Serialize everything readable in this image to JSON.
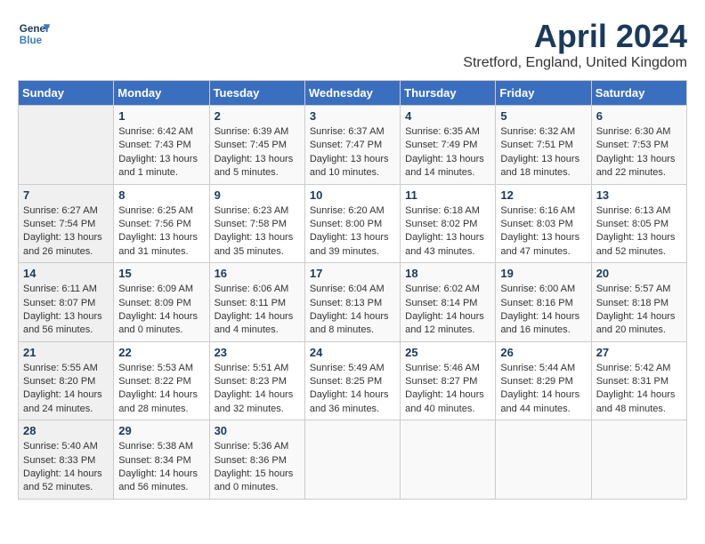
{
  "header": {
    "logo_general": "General",
    "logo_blue": "Blue",
    "title": "April 2024",
    "subtitle": "Stretford, England, United Kingdom"
  },
  "calendar": {
    "columns": [
      "Sunday",
      "Monday",
      "Tuesday",
      "Wednesday",
      "Thursday",
      "Friday",
      "Saturday"
    ],
    "weeks": [
      [
        {
          "day": "",
          "sunrise": "",
          "sunset": "",
          "daylight": ""
        },
        {
          "day": "1",
          "sunrise": "Sunrise: 6:42 AM",
          "sunset": "Sunset: 7:43 PM",
          "daylight": "Daylight: 13 hours and 1 minute."
        },
        {
          "day": "2",
          "sunrise": "Sunrise: 6:39 AM",
          "sunset": "Sunset: 7:45 PM",
          "daylight": "Daylight: 13 hours and 5 minutes."
        },
        {
          "day": "3",
          "sunrise": "Sunrise: 6:37 AM",
          "sunset": "Sunset: 7:47 PM",
          "daylight": "Daylight: 13 hours and 10 minutes."
        },
        {
          "day": "4",
          "sunrise": "Sunrise: 6:35 AM",
          "sunset": "Sunset: 7:49 PM",
          "daylight": "Daylight: 13 hours and 14 minutes."
        },
        {
          "day": "5",
          "sunrise": "Sunrise: 6:32 AM",
          "sunset": "Sunset: 7:51 PM",
          "daylight": "Daylight: 13 hours and 18 minutes."
        },
        {
          "day": "6",
          "sunrise": "Sunrise: 6:30 AM",
          "sunset": "Sunset: 7:53 PM",
          "daylight": "Daylight: 13 hours and 22 minutes."
        }
      ],
      [
        {
          "day": "7",
          "sunrise": "Sunrise: 6:27 AM",
          "sunset": "Sunset: 7:54 PM",
          "daylight": "Daylight: 13 hours and 26 minutes."
        },
        {
          "day": "8",
          "sunrise": "Sunrise: 6:25 AM",
          "sunset": "Sunset: 7:56 PM",
          "daylight": "Daylight: 13 hours and 31 minutes."
        },
        {
          "day": "9",
          "sunrise": "Sunrise: 6:23 AM",
          "sunset": "Sunset: 7:58 PM",
          "daylight": "Daylight: 13 hours and 35 minutes."
        },
        {
          "day": "10",
          "sunrise": "Sunrise: 6:20 AM",
          "sunset": "Sunset: 8:00 PM",
          "daylight": "Daylight: 13 hours and 39 minutes."
        },
        {
          "day": "11",
          "sunrise": "Sunrise: 6:18 AM",
          "sunset": "Sunset: 8:02 PM",
          "daylight": "Daylight: 13 hours and 43 minutes."
        },
        {
          "day": "12",
          "sunrise": "Sunrise: 6:16 AM",
          "sunset": "Sunset: 8:03 PM",
          "daylight": "Daylight: 13 hours and 47 minutes."
        },
        {
          "day": "13",
          "sunrise": "Sunrise: 6:13 AM",
          "sunset": "Sunset: 8:05 PM",
          "daylight": "Daylight: 13 hours and 52 minutes."
        }
      ],
      [
        {
          "day": "14",
          "sunrise": "Sunrise: 6:11 AM",
          "sunset": "Sunset: 8:07 PM",
          "daylight": "Daylight: 13 hours and 56 minutes."
        },
        {
          "day": "15",
          "sunrise": "Sunrise: 6:09 AM",
          "sunset": "Sunset: 8:09 PM",
          "daylight": "Daylight: 14 hours and 0 minutes."
        },
        {
          "day": "16",
          "sunrise": "Sunrise: 6:06 AM",
          "sunset": "Sunset: 8:11 PM",
          "daylight": "Daylight: 14 hours and 4 minutes."
        },
        {
          "day": "17",
          "sunrise": "Sunrise: 6:04 AM",
          "sunset": "Sunset: 8:13 PM",
          "daylight": "Daylight: 14 hours and 8 minutes."
        },
        {
          "day": "18",
          "sunrise": "Sunrise: 6:02 AM",
          "sunset": "Sunset: 8:14 PM",
          "daylight": "Daylight: 14 hours and 12 minutes."
        },
        {
          "day": "19",
          "sunrise": "Sunrise: 6:00 AM",
          "sunset": "Sunset: 8:16 PM",
          "daylight": "Daylight: 14 hours and 16 minutes."
        },
        {
          "day": "20",
          "sunrise": "Sunrise: 5:57 AM",
          "sunset": "Sunset: 8:18 PM",
          "daylight": "Daylight: 14 hours and 20 minutes."
        }
      ],
      [
        {
          "day": "21",
          "sunrise": "Sunrise: 5:55 AM",
          "sunset": "Sunset: 8:20 PM",
          "daylight": "Daylight: 14 hours and 24 minutes."
        },
        {
          "day": "22",
          "sunrise": "Sunrise: 5:53 AM",
          "sunset": "Sunset: 8:22 PM",
          "daylight": "Daylight: 14 hours and 28 minutes."
        },
        {
          "day": "23",
          "sunrise": "Sunrise: 5:51 AM",
          "sunset": "Sunset: 8:23 PM",
          "daylight": "Daylight: 14 hours and 32 minutes."
        },
        {
          "day": "24",
          "sunrise": "Sunrise: 5:49 AM",
          "sunset": "Sunset: 8:25 PM",
          "daylight": "Daylight: 14 hours and 36 minutes."
        },
        {
          "day": "25",
          "sunrise": "Sunrise: 5:46 AM",
          "sunset": "Sunset: 8:27 PM",
          "daylight": "Daylight: 14 hours and 40 minutes."
        },
        {
          "day": "26",
          "sunrise": "Sunrise: 5:44 AM",
          "sunset": "Sunset: 8:29 PM",
          "daylight": "Daylight: 14 hours and 44 minutes."
        },
        {
          "day": "27",
          "sunrise": "Sunrise: 5:42 AM",
          "sunset": "Sunset: 8:31 PM",
          "daylight": "Daylight: 14 hours and 48 minutes."
        }
      ],
      [
        {
          "day": "28",
          "sunrise": "Sunrise: 5:40 AM",
          "sunset": "Sunset: 8:33 PM",
          "daylight": "Daylight: 14 hours and 52 minutes."
        },
        {
          "day": "29",
          "sunrise": "Sunrise: 5:38 AM",
          "sunset": "Sunset: 8:34 PM",
          "daylight": "Daylight: 14 hours and 56 minutes."
        },
        {
          "day": "30",
          "sunrise": "Sunrise: 5:36 AM",
          "sunset": "Sunset: 8:36 PM",
          "daylight": "Daylight: 15 hours and 0 minutes."
        },
        {
          "day": "",
          "sunrise": "",
          "sunset": "",
          "daylight": ""
        },
        {
          "day": "",
          "sunrise": "",
          "sunset": "",
          "daylight": ""
        },
        {
          "day": "",
          "sunrise": "",
          "sunset": "",
          "daylight": ""
        },
        {
          "day": "",
          "sunrise": "",
          "sunset": "",
          "daylight": ""
        }
      ]
    ]
  }
}
